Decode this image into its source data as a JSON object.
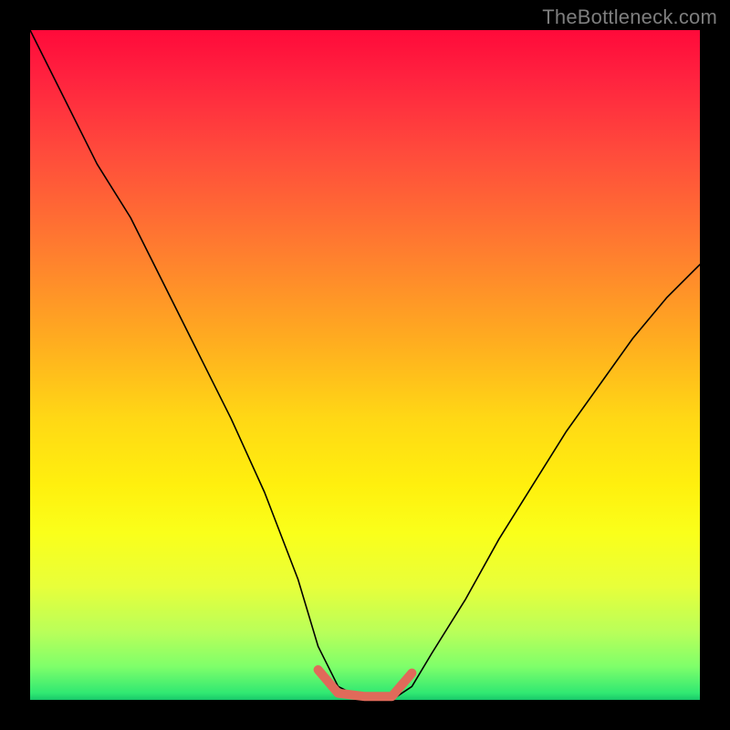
{
  "watermark": "TheBottleneck.com",
  "chart_data": {
    "type": "line",
    "title": "",
    "xlabel": "",
    "ylabel": "",
    "xlim": [
      0,
      1
    ],
    "ylim": [
      0,
      1
    ],
    "series": [
      {
        "name": "curve",
        "x": [
          0.0,
          0.05,
          0.1,
          0.15,
          0.2,
          0.25,
          0.3,
          0.35,
          0.4,
          0.43,
          0.46,
          0.5,
          0.54,
          0.57,
          0.6,
          0.65,
          0.7,
          0.75,
          0.8,
          0.85,
          0.9,
          0.95,
          1.0
        ],
        "y": [
          1.0,
          0.9,
          0.8,
          0.72,
          0.62,
          0.52,
          0.42,
          0.31,
          0.18,
          0.08,
          0.02,
          0.0,
          0.0,
          0.02,
          0.07,
          0.15,
          0.24,
          0.32,
          0.4,
          0.47,
          0.54,
          0.6,
          0.65
        ]
      }
    ],
    "annotations": [
      {
        "name": "bottom-highlight",
        "x": [
          0.43,
          0.46,
          0.5,
          0.54,
          0.57
        ],
        "y": [
          0.045,
          0.01,
          0.005,
          0.005,
          0.04
        ]
      }
    ]
  },
  "colors": {
    "background": "#000000",
    "gradient_top": "#ff0a3a",
    "gradient_bottom": "#18c86a",
    "curve": "#000000",
    "highlight": "#e06a5a",
    "watermark": "#7e7e7e"
  }
}
